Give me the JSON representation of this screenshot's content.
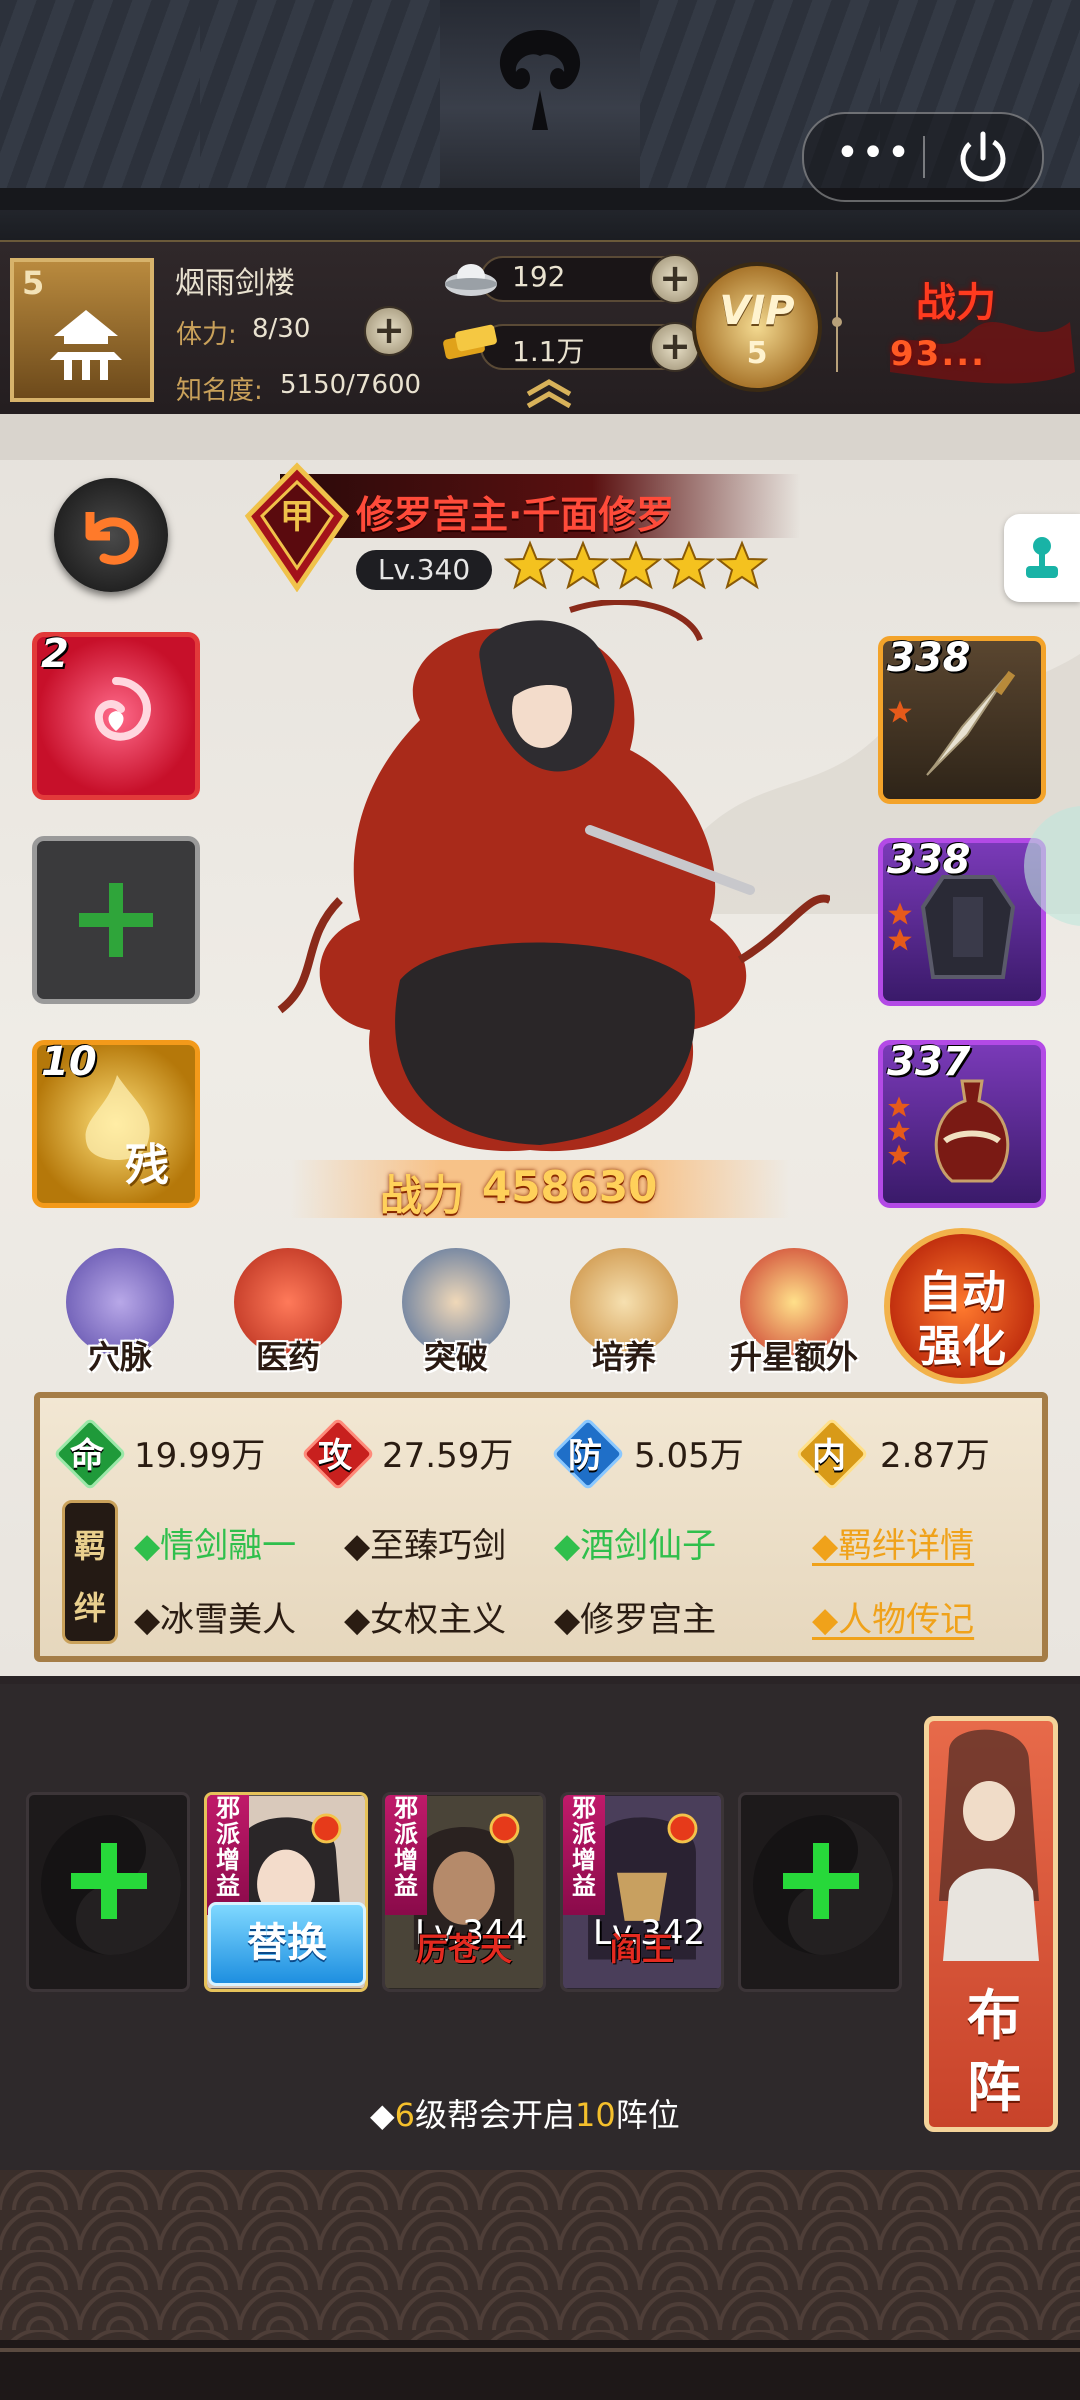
{
  "window_controls": {
    "more": "•••"
  },
  "header": {
    "guild_level": "5",
    "guild_name": "烟雨剑楼",
    "stamina_label": "体力:",
    "stamina_value": "8/30",
    "fame_label": "知名度:",
    "fame_value": "5150/7600",
    "silver": "192",
    "gold": "1.1万",
    "vip_label": "VIP",
    "vip_level": "5",
    "power_label": "战力",
    "power_value": "93..."
  },
  "hero": {
    "name": "修罗宫主·千面修罗",
    "level": "Lv.340",
    "stars": 5,
    "power_label": "战力",
    "power_value": "458630"
  },
  "slots": {
    "left": [
      {
        "num": "2"
      },
      {
        "num": ""
      },
      {
        "num": "10",
        "glyph": "残"
      }
    ],
    "right": [
      {
        "num": "338"
      },
      {
        "num": "338"
      },
      {
        "num": "337"
      }
    ]
  },
  "functions": [
    {
      "label": "穴脉"
    },
    {
      "label": "医药"
    },
    {
      "label": "突破"
    },
    {
      "label": "培养"
    },
    {
      "label": "升星额外"
    }
  ],
  "auto_boost": {
    "line1": "自动",
    "line2": "强化"
  },
  "stats": [
    {
      "icon": "命",
      "value": "19.99万",
      "color": "#1f9a3a"
    },
    {
      "icon": "攻",
      "value": "27.59万",
      "color": "#c8201e"
    },
    {
      "icon": "防",
      "value": "5.05万",
      "color": "#1f6fc8"
    },
    {
      "icon": "内",
      "value": "2.87万",
      "color": "#d89a18"
    }
  ],
  "bond": {
    "tag_top": "羁",
    "tag_bottom": "绊",
    "row1": [
      "◆情剑融一",
      "◆至臻巧剑",
      "◆酒剑仙子"
    ],
    "row2": [
      "◆冰雪美人",
      "◆女权主义",
      "◆修罗宫主"
    ],
    "link1": "◆羁绊详情",
    "link2": "◆人物传记"
  },
  "lineup": {
    "swap_label": "替换",
    "sect_tag": "邪派增益",
    "members": [
      {
        "name": "",
        "level": ""
      },
      {
        "name": "厉苍天",
        "level": "Lv.344"
      },
      {
        "name": "阎王",
        "level": "Lv.342"
      }
    ],
    "formation_label_1": "布",
    "formation_label_2": "阵",
    "tip_prefix": "◆",
    "tip_level": "6",
    "tip_mid": "级帮会开启",
    "tip_count": "10",
    "tip_suffix": "阵位"
  },
  "colors": {
    "bond_active": "#2fbf4c",
    "link": "#f0a21a",
    "hero_name": "#ff4b3a",
    "power_gold": "#ffd15a"
  }
}
